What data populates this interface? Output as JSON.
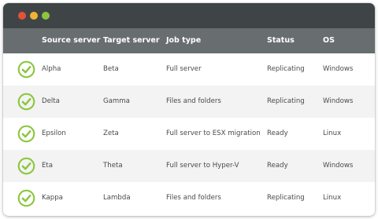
{
  "window": {
    "controls": [
      {
        "name": "close",
        "color": "#e2523c"
      },
      {
        "name": "minimize",
        "color": "#f2b335"
      },
      {
        "name": "zoom",
        "color": "#8cc63f"
      }
    ]
  },
  "columns": {
    "source": "Source server",
    "target": "Target server",
    "job": "Job type",
    "status": "Status",
    "os": "OS"
  },
  "rows": [
    {
      "source": "Alpha",
      "target": "Beta",
      "job": "Full server",
      "status": "Replicating",
      "os": "Windows",
      "icon": "check-circle-icon"
    },
    {
      "source": "Delta",
      "target": "Gamma",
      "job": "Files and folders",
      "status": "Replicating",
      "os": "Windows",
      "icon": "check-circle-icon"
    },
    {
      "source": "Epsilon",
      "target": "Zeta",
      "job": "Full server to ESX migration",
      "status": "Ready",
      "os": "Linux",
      "icon": "check-circle-icon"
    },
    {
      "source": "Eta",
      "target": "Theta",
      "job": "Full server to Hyper-V",
      "status": "Ready",
      "os": "Windows",
      "icon": "check-circle-icon"
    },
    {
      "source": "Kappa",
      "target": "Lambda",
      "job": "Files and folders",
      "status": "Replicating",
      "os": "Linux",
      "icon": "check-circle-icon"
    }
  ],
  "colors": {
    "titlebar": "#3f4547",
    "header": "#686d6f",
    "check": "#8cc63f",
    "row_alt": "#f3f3f3"
  }
}
